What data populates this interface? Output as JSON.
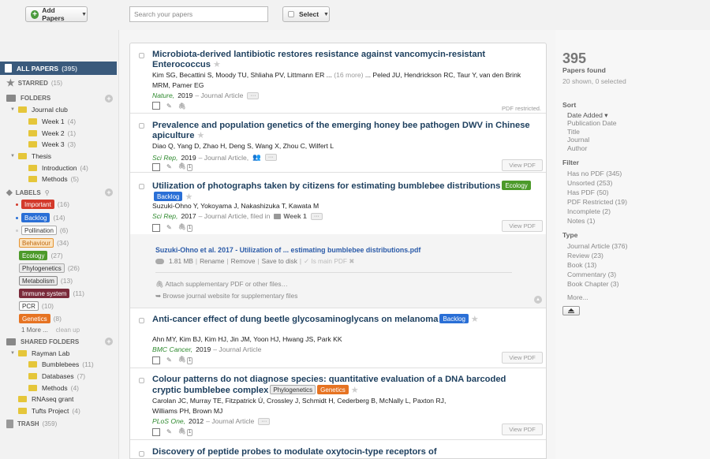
{
  "toolbar": {
    "add_label": "Add Papers",
    "search_placeholder": "Search your papers",
    "select_label": "Select"
  },
  "sidebar": {
    "all_papers": {
      "label": "ALL PAPERS",
      "count": "(395)"
    },
    "starred": {
      "label": "STARRED",
      "count": "(15)"
    },
    "folders": {
      "label": "FOLDERS",
      "items": [
        {
          "label": "Journal club",
          "count": ""
        },
        {
          "label": "Week 1",
          "count": "(4)"
        },
        {
          "label": "Week 2",
          "count": "(1)"
        },
        {
          "label": "Week 3",
          "count": "(3)"
        },
        {
          "label": "Thesis",
          "count": ""
        },
        {
          "label": "Introduction",
          "count": "(4)"
        },
        {
          "label": "Methods",
          "count": "(5)"
        }
      ]
    },
    "labels": {
      "label": "LABELS",
      "items": [
        {
          "label": "Important",
          "count": "(16)"
        },
        {
          "label": "Backlog",
          "count": "(14)"
        },
        {
          "label": "Pollination",
          "count": "(6)"
        },
        {
          "label": "Behaviour",
          "count": "(34)"
        },
        {
          "label": "Ecology",
          "count": "(27)"
        },
        {
          "label": "Phylogenetics",
          "count": "(26)"
        },
        {
          "label": "Metabolism",
          "count": "(13)"
        },
        {
          "label": "Immune system",
          "count": "(11)"
        },
        {
          "label": "PCR",
          "count": "(10)"
        },
        {
          "label": "Genetics",
          "count": "(8)"
        }
      ],
      "more": "1 More ...",
      "cleanup": "clean up"
    },
    "shared": {
      "label": "SHARED FOLDERS",
      "items": [
        {
          "label": "Rayman Lab",
          "count": ""
        },
        {
          "label": "Bumblebees",
          "count": "(11)"
        },
        {
          "label": "Databases",
          "count": "(7)"
        },
        {
          "label": "Methods",
          "count": "(4)"
        },
        {
          "label": "RNAseq grant",
          "count": ""
        },
        {
          "label": "Tufts Project",
          "count": "(4)"
        }
      ]
    },
    "trash": {
      "label": "TRASH",
      "count": "(359)"
    }
  },
  "papers": [
    {
      "title": "Microbiota-derived lantibiotic restores resistance against vancomycin-resistant Enterococcus",
      "authors_a": "Kim SG, Becattini S, Moody TU, Shliaha PV, Littmann ER ...",
      "authors_more": "(16 more)",
      "authors_b": "... Peled JU, Hendrickson RC, Taur Y, van den Brink MRM, Pamer EG",
      "journal": "Nature,",
      "year": "2019",
      "type": "– Journal Article",
      "note": "PDF restricted."
    },
    {
      "title": "Prevalence and population genetics of the emerging honey bee pathogen DWV in Chinese apiculture",
      "authors": "Diao Q, Yang D, Zhao H, Deng S, Wang X, Zhou C, Wilfert L",
      "journal": "Sci Rep,",
      "year": "2019",
      "type": "– Journal Article,",
      "clip": "1",
      "view": "View PDF"
    },
    {
      "title": "Utilization of photographs taken by citizens for estimating bumblebee distributions",
      "tags": [
        "Ecology",
        "Backlog"
      ],
      "authors": "Suzuki-Ohno Y, Yokoyama J, Nakashizuka T, Kawata M",
      "journal": "Sci Rep,",
      "year": "2017",
      "type": "– Journal Article, filed in",
      "folder": "Week 1",
      "clip": "1",
      "view": "View PDF"
    },
    {
      "title": "Anti-cancer effect of dung beetle glycosaminoglycans on melanoma",
      "tags": [
        "Backlog"
      ],
      "authors": "Ahn MY, Kim BJ, Kim HJ, Jin JM, Yoon HJ, Hwang JS, Park KK",
      "journal": "BMC Cancer,",
      "year": "2019",
      "type": "– Journal Article",
      "clip": "1",
      "view": "View PDF"
    },
    {
      "title": "Colour patterns do not diagnose species: quantitative evaluation of a DNA barcoded cryptic bumblebee complex",
      "tags": [
        "Phylogenetics",
        "Genetics"
      ],
      "authors": "Carolan JC, Murray TE, Fitzpatrick Ú, Crossley J, Schmidt H, Cederberg B, McNally L, Paxton RJ, Williams PH, Brown MJ",
      "journal": "PLoS One,",
      "year": "2012",
      "type": "– Journal Article",
      "clip": "1",
      "view": "View PDF"
    },
    {
      "title": "Discovery of peptide probes to modulate oxytocin-type receptors of"
    }
  ],
  "detail": {
    "pdf_link": "Suzuki-Ohno et al. 2017 - Utilization of ... estimating bumblebee distributions.pdf",
    "size": "1.81 MB",
    "rename": "Rename",
    "remove": "Remove",
    "save": "Save to disk",
    "main": "✓ Is main PDF ✖",
    "attach": "Attach supplementary PDF or other files…",
    "browse": "Browse journal website for supplementary files"
  },
  "right": {
    "count": "395",
    "found": "Papers found",
    "shown": "20 shown, 0 selected",
    "sort_title": "Sort",
    "sort": [
      "Date Added ▾",
      "Publication Date",
      "Title",
      "Journal",
      "Author"
    ],
    "filter_title": "Filter",
    "filter": [
      "Has no PDF (345)",
      "Unsorted (253)",
      "Has PDF (50)",
      "PDF Restricted (19)",
      "Incomplete (2)",
      "Notes (1)"
    ],
    "type_title": "Type",
    "type": [
      "Journal Article (376)",
      "Review (23)",
      "Book (13)",
      "Commentary (3)",
      "Book Chapter (3)"
    ],
    "more": "More..."
  },
  "colors": {
    "sidebar_active": "#3a5a7c",
    "title": "#1d3f5e",
    "journal": "#2f8a2f",
    "link": "#2a5aa8"
  }
}
